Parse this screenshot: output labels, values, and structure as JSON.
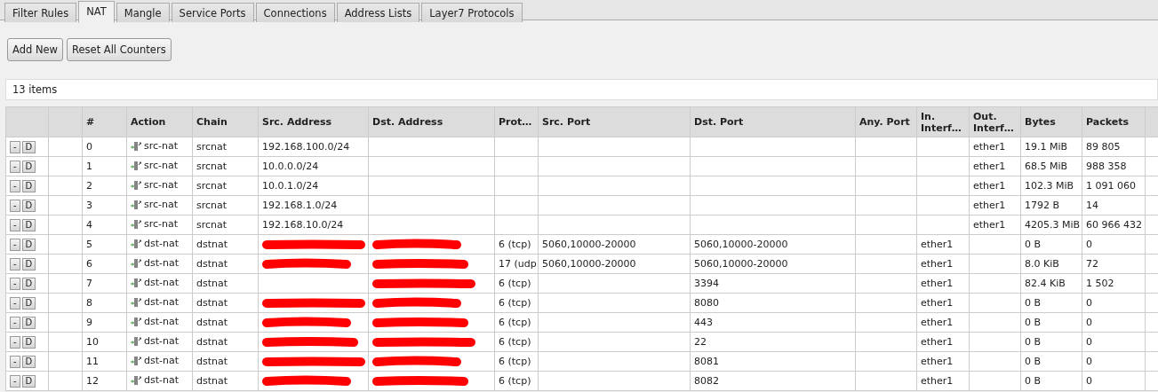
{
  "tabs": [
    {
      "label": "Filter Rules",
      "selected": false
    },
    {
      "label": "NAT",
      "selected": true
    },
    {
      "label": "Mangle",
      "selected": false
    },
    {
      "label": "Service Ports",
      "selected": false
    },
    {
      "label": "Connections",
      "selected": false
    },
    {
      "label": "Address Lists",
      "selected": false
    },
    {
      "label": "Layer7 Protocols",
      "selected": false
    }
  ],
  "buttons": [
    "Add New",
    "Reset All Counters"
  ],
  "item_count": "13 items",
  "table": {
    "columns": [
      "#",
      "Action",
      "Chain",
      "Src. Address",
      "Dst. Address",
      "Prot…",
      "Src. Port",
      "Dst. Port",
      "Any. Port",
      "In. Interf…",
      "Out. Interf…",
      "Bytes",
      "Packets"
    ],
    "rows": [
      {
        "buttons": [
          "-",
          "D"
        ],
        "cells": [
          {
            "text": "0"
          },
          {
            "text": "src-nat"
          },
          {
            "text": "srcnat"
          },
          {
            "text": "192.168.100.0/24"
          },
          {},
          {},
          {},
          {},
          {},
          {},
          {
            "text": "ether1"
          },
          {
            "text": "19.1 MiB"
          },
          {
            "text": "89 805"
          }
        ]
      },
      {
        "buttons": [
          "-",
          "D"
        ],
        "cells": [
          {
            "text": "1"
          },
          {
            "text": "src-nat"
          },
          {
            "text": "srcnat"
          },
          {
            "text": "10.0.0.0/24"
          },
          {},
          {},
          {},
          {},
          {},
          {},
          {
            "text": "ether1"
          },
          {
            "text": "68.5 MiB"
          },
          {
            "text": "988 358"
          }
        ]
      },
      {
        "buttons": [
          "-",
          "D"
        ],
        "cells": [
          {
            "text": "2"
          },
          {
            "text": "src-nat"
          },
          {
            "text": "srcnat"
          },
          {
            "text": "10.0.1.0/24"
          },
          {},
          {},
          {},
          {},
          {},
          {},
          {
            "text": "ether1"
          },
          {
            "text": "102.3 MiB"
          },
          {
            "text": "1 091 060"
          }
        ]
      },
      {
        "buttons": [
          "-",
          "D"
        ],
        "cells": [
          {
            "text": "3"
          },
          {
            "text": "src-nat"
          },
          {
            "text": "srcnat"
          },
          {
            "text": "192.168.1.0/24"
          },
          {},
          {},
          {},
          {},
          {},
          {},
          {
            "text": "ether1"
          },
          {
            "text": "1792 B"
          },
          {
            "text": "14"
          }
        ]
      },
      {
        "buttons": [
          "-",
          "D"
        ],
        "cells": [
          {
            "text": "4"
          },
          {
            "text": "src-nat"
          },
          {
            "text": "srcnat"
          },
          {
            "text": "192.168.10.0/24"
          },
          {},
          {},
          {},
          {},
          {},
          {},
          {
            "text": "ether1"
          },
          {
            "text": "4205.3 MiB"
          },
          {
            "text": "60 966 432"
          }
        ]
      },
      {
        "buttons": [
          "-",
          "D"
        ],
        "cells": [
          {
            "text": "5"
          },
          {
            "text": "dst-nat"
          },
          {
            "text": "dstnat"
          },
          {
            "redacted": true
          },
          {
            "redacted": true
          },
          {
            "text": "6 (tcp)"
          },
          {
            "text": "5060,10000-20000"
          },
          {
            "text": "5060,10000-20000"
          },
          {},
          {
            "text": "ether1"
          },
          {},
          {
            "text": "0 B"
          },
          {
            "text": "0"
          }
        ]
      },
      {
        "buttons": [
          "-",
          "D"
        ],
        "cells": [
          {
            "text": "6"
          },
          {
            "text": "dst-nat"
          },
          {
            "text": "dstnat"
          },
          {
            "redacted": true
          },
          {
            "redacted": true
          },
          {
            "text": "17 (udp"
          },
          {
            "text": "5060,10000-20000"
          },
          {
            "text": "5060,10000-20000"
          },
          {},
          {
            "text": "ether1"
          },
          {},
          {
            "text": "8.0 KiB"
          },
          {
            "text": "72"
          }
        ]
      },
      {
        "buttons": [
          "-",
          "D"
        ],
        "cells": [
          {
            "text": "7"
          },
          {
            "text": "dst-nat"
          },
          {
            "text": "dstnat"
          },
          {},
          {
            "redacted": true
          },
          {
            "text": "6 (tcp)"
          },
          {},
          {
            "text": "3394"
          },
          {},
          {
            "text": "ether1"
          },
          {},
          {
            "text": "82.4 KiB"
          },
          {
            "text": "1 502"
          }
        ]
      },
      {
        "buttons": [
          "-",
          "D"
        ],
        "cells": [
          {
            "text": "8"
          },
          {
            "text": "dst-nat"
          },
          {
            "text": "dstnat"
          },
          {
            "redacted": true
          },
          {
            "redacted": true
          },
          {
            "text": "6 (tcp)"
          },
          {},
          {
            "text": "8080"
          },
          {},
          {
            "text": "ether1"
          },
          {},
          {
            "text": "0 B"
          },
          {
            "text": "0"
          }
        ]
      },
      {
        "buttons": [
          "-",
          "D"
        ],
        "cells": [
          {
            "text": "9"
          },
          {
            "text": "dst-nat"
          },
          {
            "text": "dstnat"
          },
          {
            "redacted": true
          },
          {
            "redacted": true
          },
          {
            "text": "6 (tcp)"
          },
          {},
          {
            "text": "443"
          },
          {},
          {
            "text": "ether1"
          },
          {},
          {
            "text": "0 B"
          },
          {
            "text": "0"
          }
        ]
      },
      {
        "buttons": [
          "-",
          "D"
        ],
        "cells": [
          {
            "text": "10"
          },
          {
            "text": "dst-nat"
          },
          {
            "text": "dstnat"
          },
          {
            "redacted": true
          },
          {
            "redacted": true
          },
          {
            "text": "6 (tcp)"
          },
          {},
          {
            "text": "22"
          },
          {},
          {
            "text": "ether1"
          },
          {},
          {
            "text": "0 B"
          },
          {
            "text": "0"
          }
        ]
      },
      {
        "buttons": [
          "-",
          "D"
        ],
        "cells": [
          {
            "text": "11"
          },
          {
            "text": "dst-nat"
          },
          {
            "text": "dstnat"
          },
          {
            "redacted": true
          },
          {
            "redacted": true
          },
          {
            "text": "6 (tcp)"
          },
          {},
          {
            "text": "8081"
          },
          {},
          {
            "text": "ether1"
          },
          {},
          {
            "text": "0 B"
          },
          {
            "text": "0"
          }
        ]
      },
      {
        "buttons": [
          "-",
          "D"
        ],
        "cells": [
          {
            "text": "12"
          },
          {
            "text": "dst-nat"
          },
          {
            "text": "dstnat"
          },
          {
            "redacted": true
          },
          {
            "redacted": true
          },
          {
            "text": "6 (tcp)"
          },
          {},
          {
            "text": "8082"
          },
          {},
          {
            "text": "ether1"
          },
          {},
          {
            "text": "0 B"
          },
          {
            "text": "0"
          }
        ]
      }
    ]
  }
}
